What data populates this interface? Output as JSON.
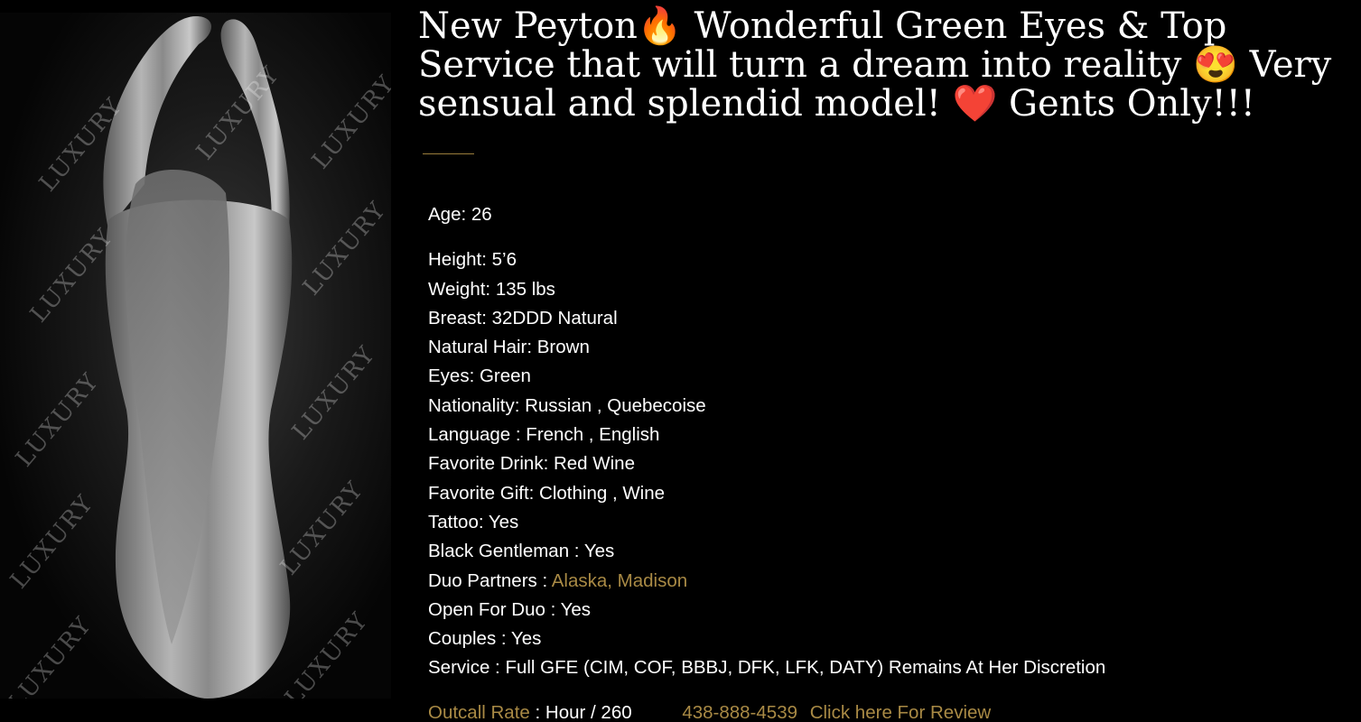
{
  "photo": {
    "watermark_text": "LUXURY"
  },
  "title": "New Peyton🔥 Wonderful Green Eyes & Top Service that will turn a dream into reality 😍 Very sensual and splendid model! ❤️ Gents Only!!!",
  "details": {
    "age": "Age: 26",
    "height": "Height: 5’6",
    "weight": "Weight: 135 lbs",
    "breast": "Breast: 32DDD Natural",
    "hair": "Natural Hair: Brown",
    "eyes": "Eyes: Green",
    "nationality": "Nationality: Russian , Quebecoise",
    "language": "Language : French , English",
    "drink": "Favorite Drink: Red Wine",
    "gift": "Favorite Gift: Clothing , Wine",
    "tattoo": "Tattoo: Yes",
    "black_gentleman": "Black Gentleman : Yes",
    "duo_partners_label": "Duo Partners : ",
    "duo_partners_link": "Alaska, Madison",
    "open_for_duo": "Open For Duo : Yes",
    "couples": "Couples : Yes",
    "service": "Service : Full GFE (CIM, COF, BBBJ, DFK, LFK, DATY)  Remains At Her Discretion"
  },
  "rates": {
    "outcall_link": "Outcall Rate",
    "outcall_value": " : Hour / 260",
    "phone": "438-888-4539",
    "review_link": "Click here For Review"
  },
  "colors": {
    "background": "#000000",
    "text": "#ffffff",
    "accent_gold": "#a98a45"
  }
}
